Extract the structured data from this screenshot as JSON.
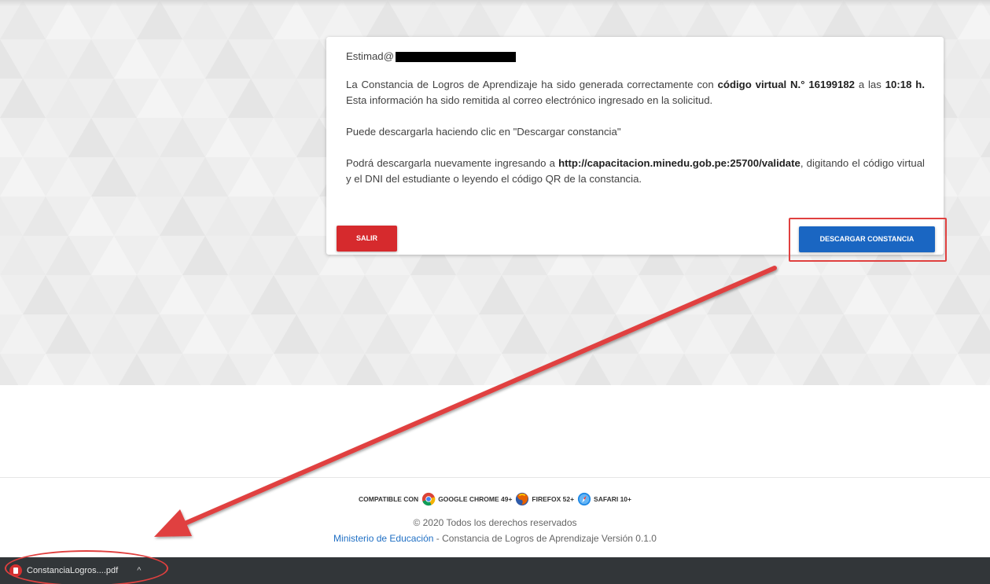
{
  "card": {
    "greeting": "Estimad@",
    "message": {
      "p1_a": "La Constancia de Logros de Aprendizaje ha sido generada correctamente con ",
      "p1_code": "código virtual N.° 16199182",
      "p1_b": " a las ",
      "p1_time": "10:18 h.",
      "p1_c": " Esta información ha sido remitida al correo electrónico ingresado en la solicitud.",
      "p2": "Puede descargarla haciendo clic en \"Descargar constancia\"",
      "p3_a": "Podrá descargarla nuevamente ingresando a ",
      "p3_url": "http://capacitacion.minedu.gob.pe:25700/validate",
      "p3_b": ", digitando el código virtual y el DNI del estudiante o leyendo el código QR de la constancia."
    },
    "exit_label": "SALIR",
    "download_label": "DESCARGAR CONSTANCIA"
  },
  "footer": {
    "compatible_label": "COMPATIBLE CON",
    "browsers": [
      {
        "name": "GOOGLE CHROME 49+",
        "icon": "chrome-icon"
      },
      {
        "name": "FIREFOX 52+",
        "icon": "firefox-icon"
      },
      {
        "name": "SAFARI 10+",
        "icon": "safari-icon"
      }
    ],
    "copyright": "© 2020 Todos los derechos reservados",
    "ministry_link": "Ministerio de Educación",
    "app_version": " - Constancia de Logros de Aprendizaje Versión 0.1.0"
  },
  "downloads": {
    "file_name": "ConstanciaLogros....pdf",
    "chevron": "^"
  },
  "colors": {
    "exit_button": "#d62a2d",
    "download_button": "#1a66c2",
    "annotation": "#e0403f",
    "downloads_bar": "#323639"
  }
}
